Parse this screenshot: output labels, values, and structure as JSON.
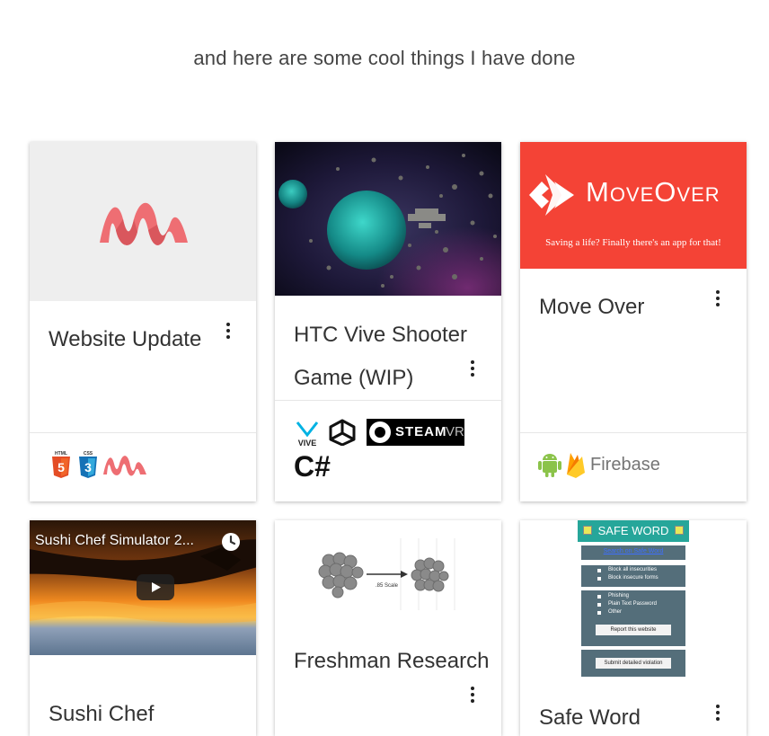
{
  "header": {
    "subtitle": "and here are some cool things I have done"
  },
  "cards": [
    {
      "title": "Website Update",
      "tech": [
        "html5-icon",
        "css3-icon",
        "materialize-icon"
      ]
    },
    {
      "title_line1": "HTC Vive Shooter",
      "title_line2": "Game (WIP)",
      "tech": [
        "vive-icon",
        "unity-icon",
        "steamvr-logo",
        "csharp"
      ],
      "steam_label": "STEAM",
      "vr_label": "VR",
      "csharp_label": "C#"
    },
    {
      "title": "Move Over",
      "logo_text": "MoveOver",
      "tagline": "Saving a life? Finally there's an app for that!",
      "tech": [
        "android-icon",
        "firebase-icon"
      ],
      "firebase_label": "Firebase"
    },
    {
      "title": "Sushi Chef",
      "video_title": "Sushi Chef Simulator 2..."
    },
    {
      "title": "Freshman Research",
      "scale_label": ".85 Scale"
    },
    {
      "title": "Safe Word",
      "app_header": "SAFE WORD",
      "search_link": "Search on Safe Word",
      "group1": [
        "Block all insecurities",
        "Block insecure forms"
      ],
      "group2": [
        "Phishing",
        "Plain Text Password",
        "Other"
      ],
      "report_button": "Report this website",
      "submit_button": "Submit detailed violation"
    }
  ],
  "colors": {
    "materialize_pink": "#ee6e73",
    "moveover_red": "#f44336",
    "safeword_teal": "#26a69a",
    "safeword_slate": "#546e7a"
  }
}
